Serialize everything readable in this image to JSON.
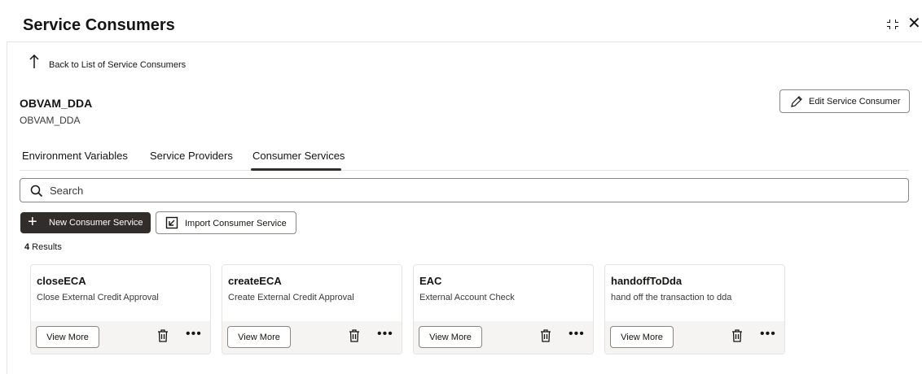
{
  "header": {
    "title": "Service Consumers",
    "collapse_icon": "collapse-icon",
    "close_icon": "close-icon",
    "close_glyph": "✕"
  },
  "back_link": {
    "label": "Back to List of Service Consumers",
    "icon": "arrow-up-icon"
  },
  "consumer": {
    "name": "OBVAM_DDA",
    "subtitle": "OBVAM_DDA"
  },
  "edit_button": {
    "label": "Edit Service Consumer",
    "icon": "pencil-icon"
  },
  "tabs": [
    {
      "label": "Environment Variables",
      "selected": false
    },
    {
      "label": "Service Providers",
      "selected": false
    },
    {
      "label": "Consumer Services",
      "selected": true
    }
  ],
  "search": {
    "placeholder": "Search",
    "value": "",
    "icon": "search-icon"
  },
  "toolbar": {
    "new_label": "New Consumer Service",
    "import_label": "Import Consumer Service"
  },
  "results": {
    "count": "4",
    "label": " Results"
  },
  "cards": [
    {
      "title": "closeECA",
      "description": "Close External Credit Approval",
      "view_label": "View More",
      "more": "•••"
    },
    {
      "title": "createECA",
      "description": "Create External Credit Approval",
      "view_label": "View More",
      "more": "•••"
    },
    {
      "title": "EAC",
      "description": "External Account Check",
      "view_label": "View More",
      "more": "•••"
    },
    {
      "title": "handoffToDda",
      "description": "hand off the transaction to dda",
      "view_label": "View More",
      "more": "•••"
    }
  ],
  "colors": {
    "primary_button": "#312d2a",
    "border": "#8a8782",
    "card_footer": "#f5f4f2",
    "divider": "#e6e4e1"
  }
}
